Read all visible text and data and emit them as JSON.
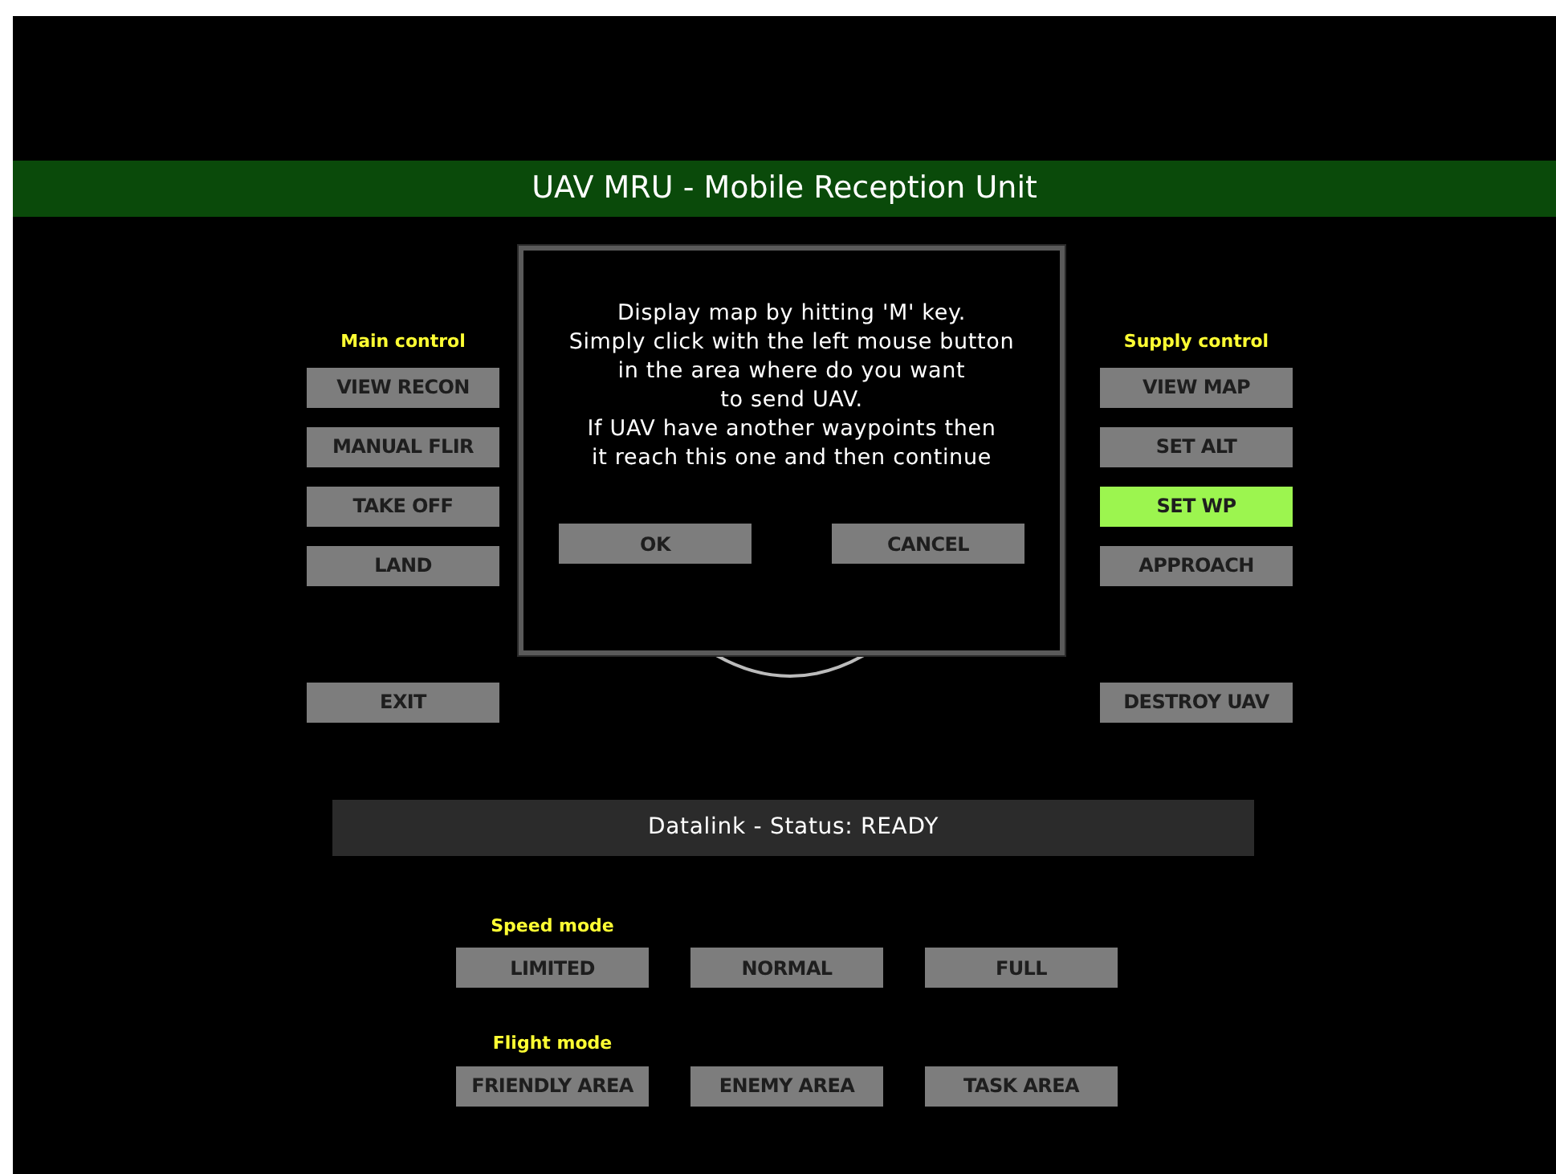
{
  "header": {
    "title": "UAV MRU - Mobile Reception Unit"
  },
  "main_control": {
    "label": "Main control",
    "buttons": [
      "VIEW RECON",
      "MANUAL FLIR",
      "TAKE OFF",
      "LAND"
    ],
    "exit_button": "EXIT"
  },
  "supply_control": {
    "label": "Supply control",
    "buttons": [
      {
        "label": "VIEW MAP",
        "selected": false
      },
      {
        "label": "SET ALT",
        "selected": false
      },
      {
        "label": "SET WP",
        "selected": true
      },
      {
        "label": "APPROACH",
        "selected": false
      }
    ],
    "destroy_button": "DESTROY UAV"
  },
  "dialog": {
    "message_lines": [
      "Display map by hitting 'M' key.",
      "Simply click with the left mouse button",
      "in the area where do you want",
      "to send UAV.",
      "If UAV have another waypoints then",
      "it reach this one and then continue"
    ],
    "buttons": [
      "OK",
      "CANCEL"
    ]
  },
  "status_bar": {
    "text": "Datalink - Status: READY"
  },
  "speed_mode": {
    "label": "Speed mode",
    "buttons": [
      "LIMITED",
      "NORMAL",
      "FULL"
    ]
  },
  "flight_mode": {
    "label": "Flight mode",
    "buttons": [
      "FRIENDLY AREA",
      "ENEMY AREA",
      "TASK AREA"
    ]
  }
}
